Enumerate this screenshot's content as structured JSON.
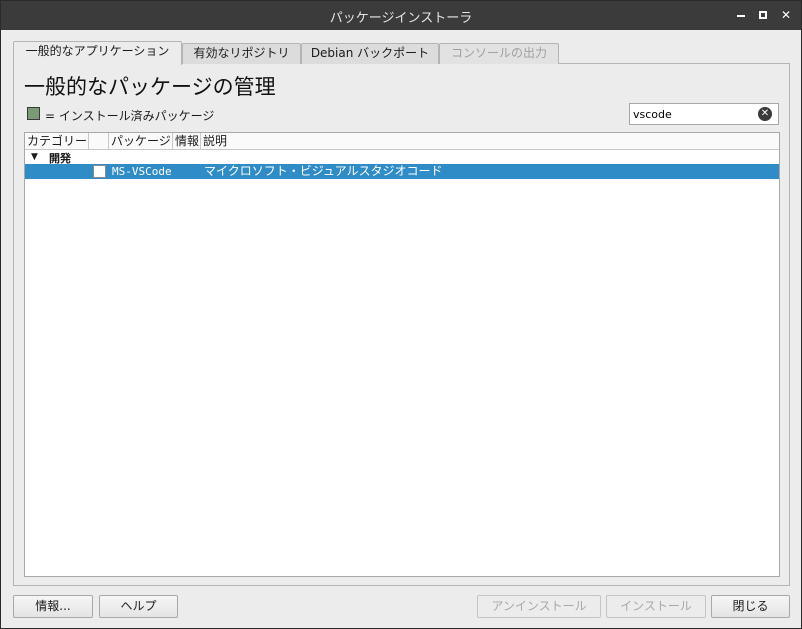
{
  "window": {
    "title": "パッケージインストーラ"
  },
  "tabs": [
    {
      "label": "一般的なアプリケーション",
      "state": "active"
    },
    {
      "label": "有効なリポジトリ",
      "state": "normal"
    },
    {
      "label": "Debian バックポート",
      "state": "normal"
    },
    {
      "label": "コンソールの出力",
      "state": "disabled"
    }
  ],
  "main": {
    "heading": "一般的なパッケージの管理",
    "legend_text": "= インストール済みパッケージ",
    "legend_color": "#7a9a76",
    "search": {
      "value": "vscode"
    }
  },
  "table": {
    "columns": [
      "カテゴリー",
      "",
      "パッケージ",
      "情報",
      "説明"
    ],
    "group": {
      "label": "開発",
      "expanded": true
    },
    "rows": [
      {
        "package": "MS-VSCode",
        "info": "",
        "description": "マイクロソフト・ビジュアルスタジオコード",
        "selected": true,
        "checked": false
      }
    ],
    "selection_color": "#308cc6"
  },
  "buttons": {
    "info": "情報...",
    "help": "ヘルプ",
    "uninstall": "アンインストール",
    "install": "インストール",
    "close": "閉じる"
  }
}
